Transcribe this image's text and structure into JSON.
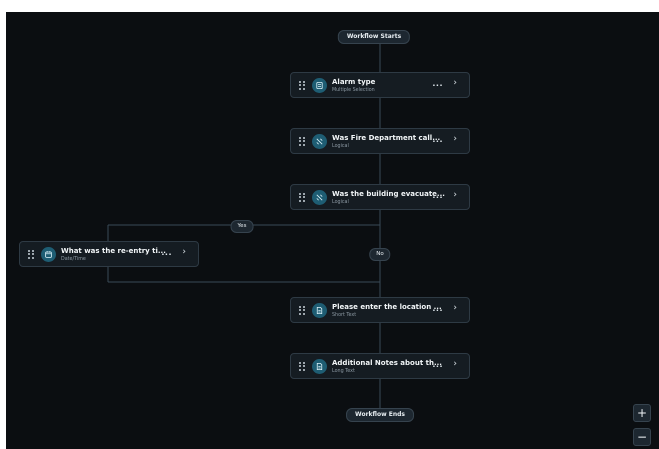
{
  "workflow": {
    "start_label": "Workflow Starts",
    "end_label": "Workflow Ends",
    "branch_yes": "Yes",
    "branch_no": "No"
  },
  "nodes": [
    {
      "title": "Alarm type",
      "subtitle": "Multiple Selection",
      "icon": "list-icon"
    },
    {
      "title": "Was Fire Department call...",
      "subtitle": "Logical",
      "icon": "logic-icon"
    },
    {
      "title": "Was the building evacuate...",
      "subtitle": "Logical",
      "icon": "logic-icon"
    },
    {
      "title": "What was the re-entry ti...",
      "subtitle": "Date/Time",
      "icon": "calendar-icon"
    },
    {
      "title": "Please enter the location ...",
      "subtitle": "Short Text",
      "icon": "document-icon"
    },
    {
      "title": "Additional Notes about th...",
      "subtitle": "Long Text",
      "icon": "document-icon"
    }
  ],
  "node_actions": {
    "more": "...",
    "open": "›"
  },
  "zoom": {
    "in": "+",
    "out": "−"
  },
  "colors": {
    "canvas": "#0b0e11",
    "node": "#151c22",
    "icon_bg": "#1e5d73",
    "line": "#3a4a56"
  }
}
